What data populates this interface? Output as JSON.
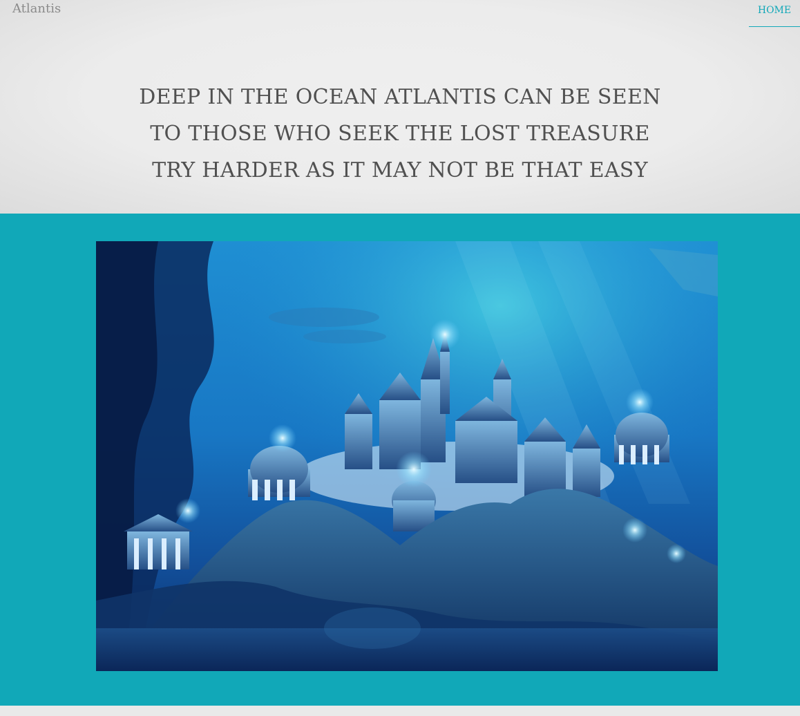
{
  "header": {
    "brand": "Atlantis",
    "nav": {
      "home_label": "HOME"
    }
  },
  "hero": {
    "lines": [
      "DEEP IN THE OCEAN ATLANTIS CAN BE SEEN",
      "TO THOSE WHO SEEK THE LOST TREASURE",
      "TRY HARDER AS IT MAY NOT BE THAT EASY"
    ]
  },
  "colors": {
    "accent": "#11a8b8",
    "header_bg": "#ececec",
    "heading_text": "#505050",
    "brand_text": "#8a8a8a"
  },
  "image": {
    "subject": "underwater city of Atlantis illustration"
  }
}
